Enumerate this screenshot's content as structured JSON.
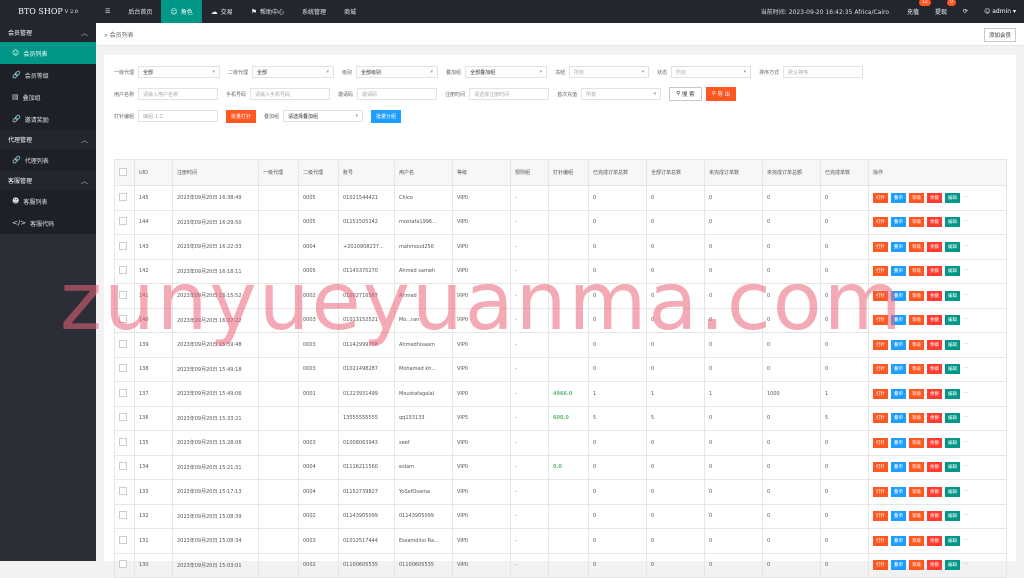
{
  "app": {
    "title": "BTO SHOP",
    "version": "V 2.0"
  },
  "nav": [
    {
      "label": "后台首页",
      "icon": "home-icon"
    },
    {
      "label": "角色",
      "icon": "user-icon",
      "active": true
    },
    {
      "label": "交易",
      "icon": "cloud-icon"
    },
    {
      "label": "帮助中心",
      "icon": "flag-icon"
    },
    {
      "label": "系统管理"
    },
    {
      "label": "商城"
    }
  ],
  "header": {
    "time": "当前时间: 2023-09-20 16:42:35  Africa/Cairo",
    "recharge": "充值",
    "recharge_badge": "12",
    "withdraw": "提现",
    "withdraw_badge": "0",
    "user": "admin"
  },
  "sidebar": {
    "groups": [
      {
        "label": "会员管理",
        "items": [
          {
            "label": "会员列表",
            "active": true
          },
          {
            "label": "会员等级"
          },
          {
            "label": "叠加组"
          },
          {
            "label": "邀请奖励"
          }
        ]
      },
      {
        "label": "代理管理",
        "items": [
          {
            "label": "代理列表"
          }
        ]
      },
      {
        "label": "客服管理",
        "items": [
          {
            "label": "客服列表"
          },
          {
            "label": "客服代码"
          }
        ]
      }
    ]
  },
  "breadcrumb": "会员列表",
  "add_member": "添加会员",
  "filters": {
    "agent1_label": "一级代理",
    "agent1_value": "全部",
    "agent2_label": "二级代理",
    "agent2_value": "全部",
    "level_label": "级别",
    "level_value": "全部级别",
    "stack_label": "叠加组",
    "stack_value": "全部叠加组",
    "freeze_label": "冻结",
    "freeze_value": "所有",
    "status_label": "状态",
    "status_value": "所有",
    "sort_label": "排序方式",
    "sort_value": "默认排序",
    "username_label": "用户名称",
    "username_ph": "请输入用户名称",
    "phone_label": "手机号码",
    "phone_ph": "请输入手机号码",
    "invite_label": "邀请码",
    "invite_ph": "邀请码",
    "regtime_label": "注册时间",
    "regtime_ph": "请选择注册时间",
    "firstpay_label": "首次充值",
    "firstpay_value": "所有",
    "search": "搜 索",
    "export": "导 出",
    "punch_label": "打针编组",
    "punch_ph": "编组 1:1",
    "batch_punch": "批量打针",
    "stack2_label": "叠加组",
    "stack2_value": "请选择叠加组",
    "batch_group": "批量分组"
  },
  "table": {
    "headers": [
      "",
      "UID",
      "注册时间",
      "一级代理",
      "二级代理",
      "账号",
      "用户名",
      "等级",
      "规则组",
      "打针编组",
      "已完成订单总数",
      "全部订单总数",
      "未完成订单数",
      "未完成订单总额",
      "已完成单数",
      "操作"
    ],
    "ops": [
      "打针",
      "叠单",
      "等级",
      "余额",
      "编辑"
    ],
    "rows": [
      {
        "uid": "145",
        "time": "2023年09月20日 16:38:49",
        "a1": "",
        "a2": "0005",
        "acct": "01021544421",
        "name": "Chico",
        "lvl": "VIP0",
        "rule": "-",
        "punch": "",
        "done": "0",
        "all": "0",
        "undone": "0",
        "undone_amt": "0",
        "done_cnt": "0"
      },
      {
        "uid": "144",
        "time": "2023年09月20日 16:29:50",
        "a1": "",
        "a2": "0005",
        "acct": "01151505142",
        "name": "mostafa1996...",
        "lvl": "VIP0",
        "rule": "-",
        "punch": "",
        "done": "0",
        "all": "0",
        "undone": "0",
        "undone_amt": "0",
        "done_cnt": "0"
      },
      {
        "uid": "143",
        "time": "2023年09月20日 16:22:33",
        "a1": "",
        "a2": "0004",
        "acct": "+2010908237...",
        "name": "mahmoud256",
        "lvl": "VIP0",
        "rule": "-",
        "punch": "",
        "done": "0",
        "all": "0",
        "undone": "0",
        "undone_amt": "0",
        "done_cnt": "0"
      },
      {
        "uid": "142",
        "time": "2023年09月20日 16:18:11",
        "a1": "",
        "a2": "0005",
        "acct": "01145370270",
        "name": "Ahmed sameh",
        "lvl": "VIP0",
        "rule": "-",
        "punch": "",
        "done": "0",
        "all": "0",
        "undone": "0",
        "undone_amt": "0",
        "done_cnt": "0"
      },
      {
        "uid": "141",
        "time": "2023年09月20日 16:15:52",
        "a1": "",
        "a2": "0002",
        "acct": "01002716567",
        "name": "Ahmed",
        "lvl": "VIP0",
        "rule": "-",
        "punch": "",
        "done": "0",
        "all": "0",
        "undone": "0",
        "undone_amt": "0",
        "done_cnt": "0"
      },
      {
        "uid": "140",
        "time": "2023年09月20日 16:07:22",
        "a1": "",
        "a2": "0003",
        "acct": "01013152521",
        "name": "Mo...ran",
        "lvl": "VIP0",
        "rule": "-",
        "punch": "",
        "done": "0",
        "all": "0",
        "undone": "0",
        "undone_amt": "0",
        "done_cnt": "0"
      },
      {
        "uid": "139",
        "time": "2023年09月20日 15:59:48",
        "a1": "",
        "a2": "0003",
        "acct": "01142999758",
        "name": "Ahmedhisaam",
        "lvl": "VIP0",
        "rule": "-",
        "punch": "",
        "done": "0",
        "all": "0",
        "undone": "0",
        "undone_amt": "0",
        "done_cnt": "0"
      },
      {
        "uid": "138",
        "time": "2023年09月20日 15:49:18",
        "a1": "",
        "a2": "0003",
        "acct": "01021498287",
        "name": "Mohamed kh...",
        "lvl": "VIP0",
        "rule": "-",
        "punch": "",
        "done": "0",
        "all": "0",
        "undone": "0",
        "undone_amt": "0",
        "done_cnt": "0"
      },
      {
        "uid": "137",
        "time": "2023年09月20日 15:49:06",
        "a1": "",
        "a2": "0001",
        "acct": "01223931499",
        "name": "Moustafagalal",
        "lvl": "VIP0",
        "rule": "-",
        "punch": "4966.0",
        "done": "1",
        "all": "1",
        "undone": "1",
        "undone_amt": "1000",
        "done_cnt": "1"
      },
      {
        "uid": "136",
        "time": "2023年09月20日 15:33:21",
        "a1": "",
        "a2": "",
        "acct": "13555555555",
        "name": "qq133133",
        "lvl": "VIP5",
        "rule": "-",
        "punch": "600.0",
        "done": "5",
        "all": "5",
        "undone": "0",
        "undone_amt": "0",
        "done_cnt": "5"
      },
      {
        "uid": "135",
        "time": "2023年09月20日 15:28:06",
        "a1": "",
        "a2": "0003",
        "acct": "01008063943",
        "name": "seef",
        "lvl": "VIP0",
        "rule": "-",
        "punch": "",
        "done": "0",
        "all": "0",
        "undone": "0",
        "undone_amt": "0",
        "done_cnt": "0"
      },
      {
        "uid": "134",
        "time": "2023年09月20日 15:21:31",
        "a1": "",
        "a2": "0004",
        "acct": "01116211560",
        "name": "eslam",
        "lvl": "VIP0",
        "rule": "-",
        "punch": "0.0",
        "done": "0",
        "all": "0",
        "undone": "0",
        "undone_amt": "0",
        "done_cnt": "0"
      },
      {
        "uid": "133",
        "time": "2023年09月20日 15:17:13",
        "a1": "",
        "a2": "0004",
        "acct": "01152739827",
        "name": "YoSefOsama",
        "lvl": "VIP0",
        "rule": "-",
        "punch": "",
        "done": "0",
        "all": "0",
        "undone": "0",
        "undone_amt": "0",
        "done_cnt": "0"
      },
      {
        "uid": "132",
        "time": "2023年09月20日 15:08:39",
        "a1": "",
        "a2": "0002",
        "acct": "01143905099",
        "name": "01143905099",
        "lvl": "VIP0",
        "rule": "-",
        "punch": "",
        "done": "0",
        "all": "0",
        "undone": "0",
        "undone_amt": "0",
        "done_cnt": "0"
      },
      {
        "uid": "131",
        "time": "2023年09月20日 15:08:34",
        "a1": "",
        "a2": "0003",
        "acct": "01012517444",
        "name": "Essamdino Ra...",
        "lvl": "VIP0",
        "rule": "-",
        "punch": "",
        "done": "0",
        "all": "0",
        "undone": "0",
        "undone_amt": "0",
        "done_cnt": "0"
      },
      {
        "uid": "130",
        "time": "2023年09月20日 15:03:01",
        "a1": "",
        "a2": "0002",
        "acct": "01100605535",
        "name": "01100605535",
        "lvl": "VIP0",
        "rule": "-",
        "punch": "",
        "done": "0",
        "all": "0",
        "undone": "0",
        "undone_amt": "0",
        "done_cnt": "0"
      }
    ]
  },
  "watermark": "zunyueyuanma.com"
}
